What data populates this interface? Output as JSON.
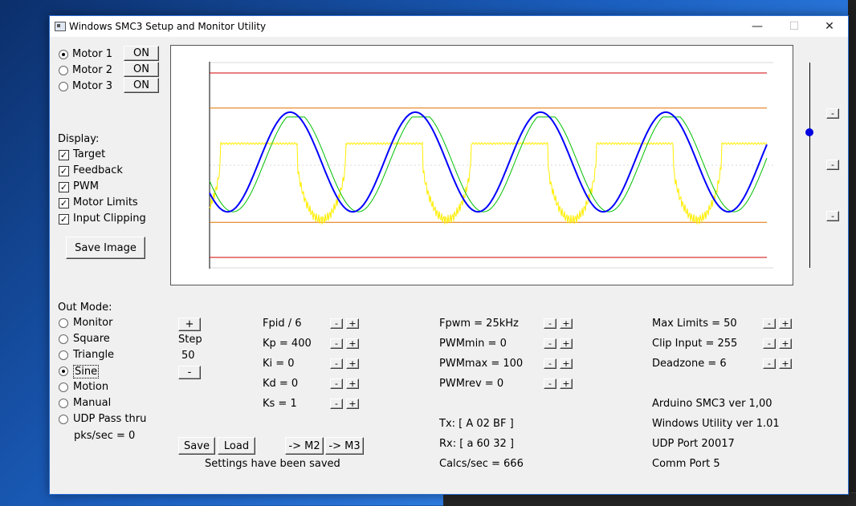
{
  "window": {
    "title": "Windows SMC3 Setup and Monitor Utility",
    "minimize": "—",
    "maximize": "☐",
    "close": "✕"
  },
  "motors": [
    {
      "label": "Motor 1",
      "selected": true,
      "button": "ON"
    },
    {
      "label": "Motor 2",
      "selected": false,
      "button": "ON"
    },
    {
      "label": "Motor 3",
      "selected": false,
      "button": "ON"
    }
  ],
  "display": {
    "heading": "Display:",
    "items": [
      {
        "label": "Target",
        "checked": true
      },
      {
        "label": "Feedback",
        "checked": true
      },
      {
        "label": "PWM",
        "checked": true
      },
      {
        "label": "Motor Limits",
        "checked": true
      },
      {
        "label": "Input Clipping",
        "checked": true
      }
    ],
    "check_mark": "✓",
    "save_image": "Save Image"
  },
  "out_mode": {
    "heading": "Out Mode:",
    "options": [
      {
        "label": "Monitor",
        "selected": false
      },
      {
        "label": "Square",
        "selected": false
      },
      {
        "label": "Triangle",
        "selected": false
      },
      {
        "label": "Sine",
        "selected": true
      },
      {
        "label": "Motion",
        "selected": false
      },
      {
        "label": "Manual",
        "selected": false
      },
      {
        "label": "UDP Pass thru",
        "selected": false
      }
    ],
    "pks_sec": "pks/sec = 0"
  },
  "step": {
    "plus": "+",
    "label": "Step",
    "value": "50",
    "minus": "-"
  },
  "pid": [
    {
      "label": "Fpid / 6"
    },
    {
      "label": "Kp = 400"
    },
    {
      "label": "Ki = 0"
    },
    {
      "label": "Kd = 0"
    },
    {
      "label": "Ks = 1"
    }
  ],
  "pwm": [
    {
      "label": "Fpwm = 25kHz"
    },
    {
      "label": "PWMmin = 0"
    },
    {
      "label": "PWMmax = 100"
    },
    {
      "label": "PWMrev = 0"
    }
  ],
  "limits": [
    {
      "label": "Max Limits = 50"
    },
    {
      "label": "Clip Input = 255"
    },
    {
      "label": "Deadzone = 6"
    }
  ],
  "adjust": {
    "minus": "-",
    "plus": "+"
  },
  "comms": {
    "tx": "Tx: [ A 02 BF ]",
    "rx": "Rx: [ a 60 32 ]",
    "calcs": "Calcs/sec = 666"
  },
  "info": {
    "arduino": "Arduino SMC3 ver 1,00",
    "utility": "Windows Utility ver 1.01",
    "udp": "UDP Port 20017",
    "comm": "Comm Port 5"
  },
  "settings": {
    "save": "Save",
    "load": "Load",
    "to_m2": "-> M2",
    "to_m3": "-> M3",
    "status": "Settings have been saved"
  },
  "slider": {
    "buttons": [
      "-",
      "-",
      "-"
    ],
    "level": 0.66
  },
  "plot": {
    "colors": {
      "limits": "#d00000",
      "clip": "#e07000",
      "target": "#0000ff",
      "feedback": "#00c000",
      "pwm": "#ffee00",
      "axis": "#000000",
      "grid": "#d8d8d8"
    },
    "cycles": 4.45,
    "target_amplitude": 0.54,
    "limit_level": 1.0,
    "clip_level": 0.62
  }
}
